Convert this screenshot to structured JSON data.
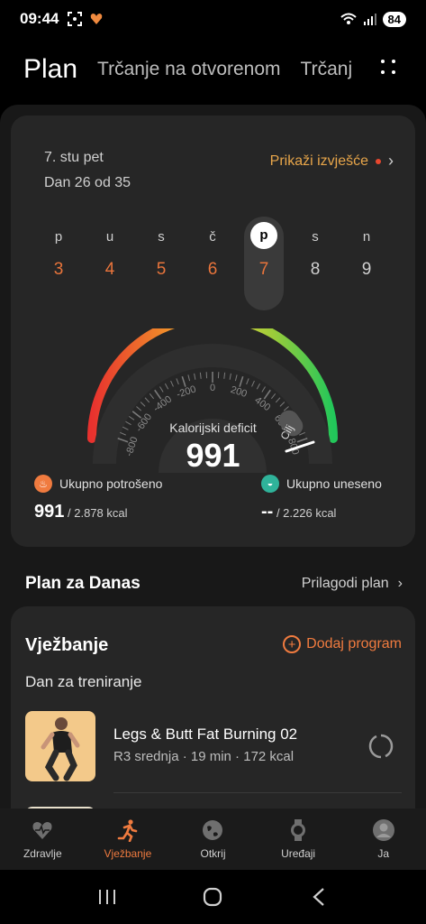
{
  "status": {
    "time": "09:44",
    "battery": "84"
  },
  "header": {
    "tabs": [
      {
        "label": "Plan"
      },
      {
        "label": "Trčanje na otvorenom"
      },
      {
        "label": "Trčanj"
      }
    ]
  },
  "summary": {
    "date": "7. stu pet",
    "day_progress": "Dan 26 od 35",
    "report_link": "Prikaži izvješće",
    "week": [
      {
        "letter": "p",
        "num": "3",
        "color": "#e8743b"
      },
      {
        "letter": "u",
        "num": "4",
        "color": "#e8743b"
      },
      {
        "letter": "s",
        "num": "5",
        "color": "#e8743b"
      },
      {
        "letter": "č",
        "num": "6",
        "color": "#e8743b"
      },
      {
        "letter": "p",
        "num": "7",
        "color": "#e8743b"
      },
      {
        "letter": "s",
        "num": "8",
        "color": "#d0d0d0"
      },
      {
        "letter": "n",
        "num": "9",
        "color": "#d0d0d0"
      }
    ],
    "gauge": {
      "ticks": [
        "-800",
        "-600",
        "-400",
        "-200",
        "0",
        "200",
        "400",
        "600",
        "800"
      ],
      "goal_label": "Cilj",
      "label": "Kalorijski deficit",
      "value": "991"
    },
    "burned": {
      "label": "Ukupno potrošeno",
      "value": "991",
      "total": "/ 2.878 kcal"
    },
    "intake": {
      "label": "Ukupno uneseno",
      "value": "--",
      "total": "/ 2.226 kcal"
    }
  },
  "plan": {
    "title": "Plan za Danas",
    "customize": "Prilagodi plan"
  },
  "exercise": {
    "title": "Vježbanje",
    "add_program": "Dodaj program",
    "day_type": "Dan za treniranje",
    "workout": {
      "name": "Legs & Butt Fat Burning 02",
      "meta": "R3 srednja · 19 min · 172 kcal"
    }
  },
  "bottom_nav": [
    {
      "label": "Zdravlje",
      "icon": "health-icon"
    },
    {
      "label": "Vježbanje",
      "icon": "exercise-icon"
    },
    {
      "label": "Otkrij",
      "icon": "discover-icon"
    },
    {
      "label": "Uređaji",
      "icon": "devices-icon"
    },
    {
      "label": "Ja",
      "icon": "profile-icon"
    }
  ],
  "colors": {
    "accent": "#f07b3f",
    "link": "#e8a64a",
    "card": "#262626"
  }
}
